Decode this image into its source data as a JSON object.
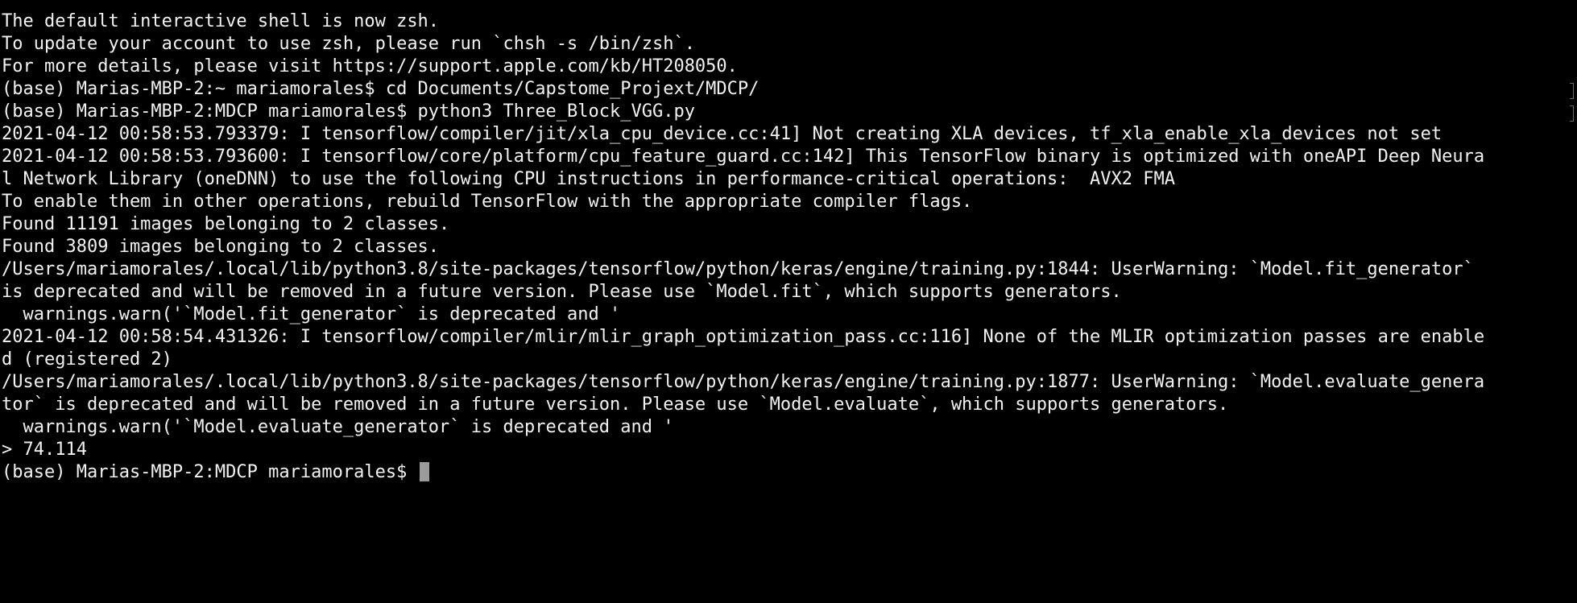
{
  "terminal": {
    "lines": [
      "The default interactive shell is now zsh.",
      "To update your account to use zsh, please run `chsh -s /bin/zsh`.",
      "For more details, please visit https://support.apple.com/kb/HT208050.",
      "(base) Marias-MBP-2:~ mariamorales$ cd Documents/Capstome_Projext/MDCP/",
      "(base) Marias-MBP-2:MDCP mariamorales$ python3 Three_Block_VGG.py",
      "2021-04-12 00:58:53.793379: I tensorflow/compiler/jit/xla_cpu_device.cc:41] Not creating XLA devices, tf_xla_enable_xla_devices not set",
      "2021-04-12 00:58:53.793600: I tensorflow/core/platform/cpu_feature_guard.cc:142] This TensorFlow binary is optimized with oneAPI Deep Neura",
      "l Network Library (oneDNN) to use the following CPU instructions in performance-critical operations:  AVX2 FMA",
      "To enable them in other operations, rebuild TensorFlow with the appropriate compiler flags.",
      "Found 11191 images belonging to 2 classes.",
      "Found 3809 images belonging to 2 classes.",
      "/Users/mariamorales/.local/lib/python3.8/site-packages/tensorflow/python/keras/engine/training.py:1844: UserWarning: `Model.fit_generator`",
      "is deprecated and will be removed in a future version. Please use `Model.fit`, which supports generators.",
      "  warnings.warn('`Model.fit_generator` is deprecated and '",
      "2021-04-12 00:58:54.431326: I tensorflow/compiler/mlir/mlir_graph_optimization_pass.cc:116] None of the MLIR optimization passes are enable",
      "d (registered 2)",
      "/Users/mariamorales/.local/lib/python3.8/site-packages/tensorflow/python/keras/engine/training.py:1877: UserWarning: `Model.evaluate_genera",
      "tor` is deprecated and will be removed in a future version. Please use `Model.evaluate`, which supports generators.",
      "  warnings.warn('`Model.evaluate_generator` is deprecated and '",
      "> 74.114"
    ],
    "prompt": "(base) Marias-MBP-2:MDCP mariamorales$ "
  },
  "colors": {
    "background": "#000000",
    "text": "#f2f2f2",
    "cursor": "#9b9b9b"
  }
}
